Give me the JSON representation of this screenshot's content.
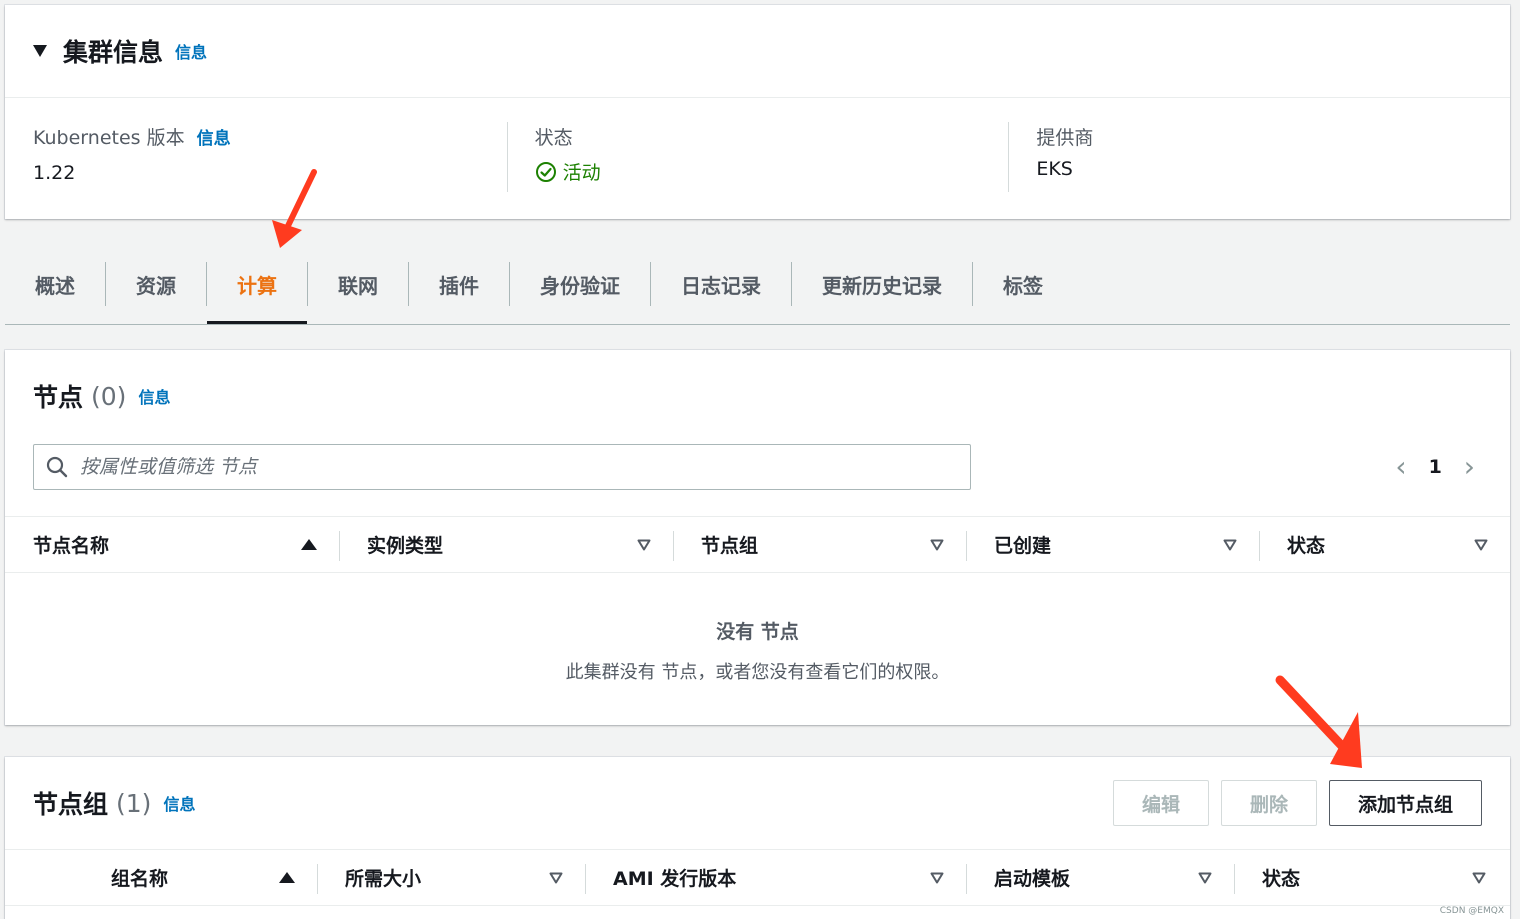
{
  "cluster_info": {
    "title": "集群信息",
    "info_link": "信息",
    "kubernetes_version": {
      "label": "Kubernetes 版本",
      "info_link": "信息",
      "value": "1.22"
    },
    "status": {
      "label": "状态",
      "value": "活动"
    },
    "provider": {
      "label": "提供商",
      "value": "EKS"
    }
  },
  "tabs": [
    {
      "label": "概述"
    },
    {
      "label": "资源"
    },
    {
      "label": "计算",
      "active": true
    },
    {
      "label": "联网"
    },
    {
      "label": "插件"
    },
    {
      "label": "身份验证"
    },
    {
      "label": "日志记录"
    },
    {
      "label": "更新历史记录"
    },
    {
      "label": "标签"
    }
  ],
  "nodes": {
    "title": "节点",
    "count": "(0)",
    "info_link": "信息",
    "search_placeholder": "按属性或值筛选 节点",
    "page": "1",
    "columns": [
      "节点名称",
      "实例类型",
      "节点组",
      "已创建",
      "状态"
    ],
    "empty_title": "没有 节点",
    "empty_sub": "此集群没有 节点，或者您没有查看它们的权限。"
  },
  "node_groups": {
    "title": "节点组",
    "count": "(1)",
    "info_link": "信息",
    "edit_label": "编辑",
    "delete_label": "删除",
    "add_label": "添加节点组",
    "columns": [
      "组名称",
      "所需大小",
      "AMI 发行版本",
      "启动模板",
      "状态"
    ]
  },
  "watermark": "CSDN @EMQX",
  "colors": {
    "accent_tab": "#ec7211",
    "link": "#0073bb",
    "status_ok": "#1d8102",
    "annotation_arrow": "#ff3b1f"
  }
}
